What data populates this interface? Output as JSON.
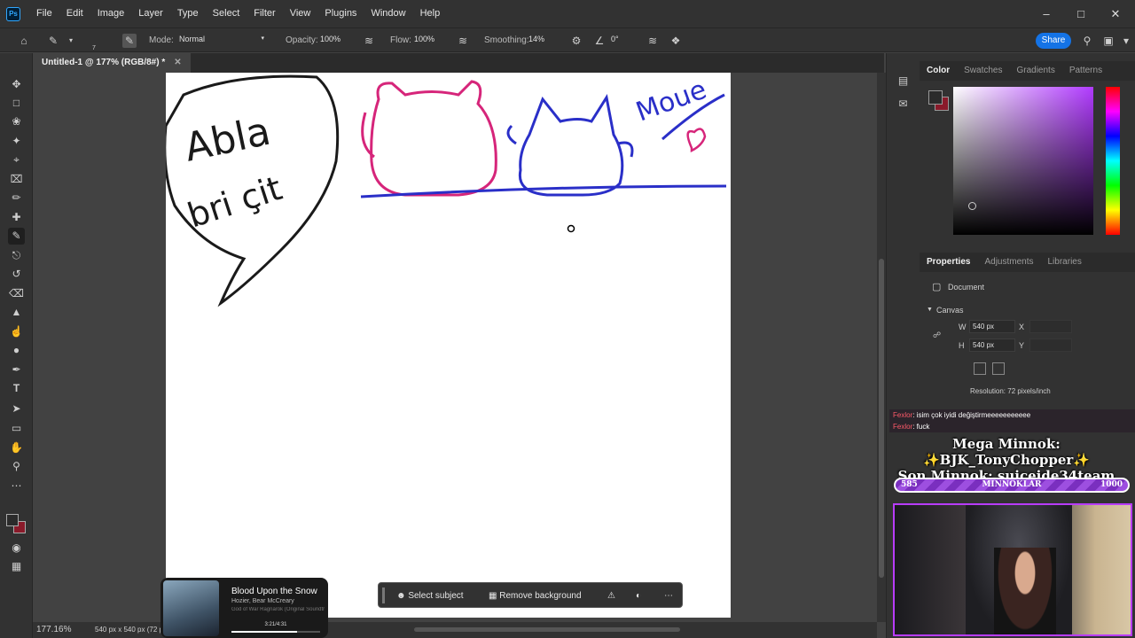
{
  "menubar": {
    "logo": "Ps",
    "items": [
      "File",
      "Edit",
      "Image",
      "Layer",
      "Type",
      "Select",
      "Filter",
      "View",
      "Plugins",
      "Window",
      "Help"
    ]
  },
  "options": {
    "mode_label": "Mode:",
    "mode_value": "Normal",
    "opacity_label": "Opacity:",
    "opacity_value": "100%",
    "flow_label": "Flow:",
    "flow_value": "100%",
    "smoothing_label": "Smoothing:",
    "smoothing_value": "14%",
    "angle_value": "0°",
    "brush_size": "7",
    "share_label": "Share"
  },
  "document": {
    "tab_title": "Untitled-1 @ 177% (RGB/8#) *",
    "canvas_text_1": "Abla",
    "canvas_text_2": "bri çit",
    "canvas_text_3": "Moue"
  },
  "status": {
    "zoom": "177.16%",
    "doc_size": "540 px x 540 px (72 ppi)"
  },
  "color_panel": {
    "tabs": [
      "Color",
      "Swatches",
      "Gradients",
      "Patterns"
    ]
  },
  "properties_panel": {
    "tabs": [
      "Properties",
      "Adjustments",
      "Libraries"
    ],
    "doc_label": "Document",
    "section": "Canvas",
    "w_label": "W",
    "w_value": "540 px",
    "h_label": "H",
    "h_value": "540 px",
    "x_label": "X",
    "y_label": "Y",
    "resolution": "Resolution: 72 pixels/inch"
  },
  "context_bar": {
    "select_subject": "Select subject",
    "remove_background": "Remove background"
  },
  "music": {
    "song": "Blood Upon the Snow",
    "artist": "Hozier, Bear McCreary",
    "album": "God of War Ragnarök (Original Soundtr...",
    "time": "3:21/4:31",
    "progress": 0.74
  },
  "stream_overlay": {
    "chat": [
      {
        "user": "Fexlor",
        "text": ": isim çok iyidi değiştirmeeeeeeeeeee"
      },
      {
        "user": "Fexlor",
        "text": ": fuck"
      }
    ],
    "mega_minnok": "Mega Minnok: ✨BJK_TonyChopper✨",
    "son_minnok": "Son Minnok: suiceide34team",
    "bar_current": "585",
    "bar_label": "MINNOKLAR",
    "bar_max": "1000",
    "bar_fill": 0.585
  },
  "colors": {
    "foreground": "#2b2b2b",
    "background": "#8a1a2a",
    "ps_blue": "#31a8ff",
    "share": "#1473e6",
    "accent_purple": "#b83cff"
  }
}
